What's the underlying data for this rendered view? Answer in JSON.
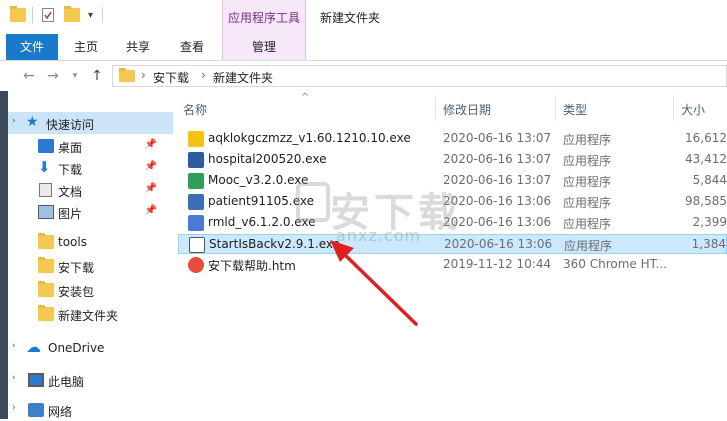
{
  "window": {
    "title": "新建文件夹",
    "context_group": "应用程序工具"
  },
  "ribbon": {
    "tabs": [
      {
        "label": "文件"
      },
      {
        "label": "主页"
      },
      {
        "label": "共享"
      },
      {
        "label": "查看"
      },
      {
        "label": "管理"
      }
    ],
    "file_color": "#1979ca",
    "context_color": "#f6e8f9"
  },
  "address": {
    "crumbs": [
      "安下载",
      "新建文件夹"
    ]
  },
  "nav": {
    "items": [
      {
        "label": "快速访问"
      },
      {
        "label": "桌面"
      },
      {
        "label": "下载"
      },
      {
        "label": "文档"
      },
      {
        "label": "图片"
      },
      {
        "label": "tools"
      },
      {
        "label": "安下载"
      },
      {
        "label": "安装包"
      },
      {
        "label": "新建文件夹"
      },
      {
        "label": "OneDrive"
      },
      {
        "label": "此电脑"
      },
      {
        "label": "网络"
      }
    ]
  },
  "columns": {
    "name": "名称",
    "date": "修改日期",
    "type": "类型",
    "size": "大小"
  },
  "files": [
    {
      "name": "aqklokgczmzz_v1.60.1210.10.exe",
      "date": "2020-06-16 13:07",
      "type": "应用程序",
      "size": "16,612",
      "icon_color": "#f1c40f"
    },
    {
      "name": "hospital200520.exe",
      "date": "2020-06-16 13:07",
      "type": "应用程序",
      "size": "43,412",
      "icon_color": "#2a5d9f"
    },
    {
      "name": "Mooc_v3.2.0.exe",
      "date": "2020-06-16 13:07",
      "type": "应用程序",
      "size": "5,844",
      "icon_color": "#2f9e58"
    },
    {
      "name": "patient91105.exe",
      "date": "2020-06-16 13:06",
      "type": "应用程序",
      "size": "98,585",
      "icon_color": "#3b6fb5"
    },
    {
      "name": "rmld_v6.1.2.0.exe",
      "date": "2020-06-16 13:06",
      "type": "应用程序",
      "size": "2,399",
      "icon_color": "#4a7bd1"
    },
    {
      "name": "StartIsBackv2.9.1.exe",
      "date": "2020-06-16 13:06",
      "type": "应用程序",
      "size": "1,384",
      "icon_color": "#555555"
    },
    {
      "name": "安下载帮助.htm",
      "date": "2019-11-12 10:44",
      "type": "360 Chrome HT...",
      "size": "",
      "icon_color": "#e74c3c"
    }
  ],
  "watermark": {
    "main": "安下载",
    "sub": "anxz.com"
  }
}
